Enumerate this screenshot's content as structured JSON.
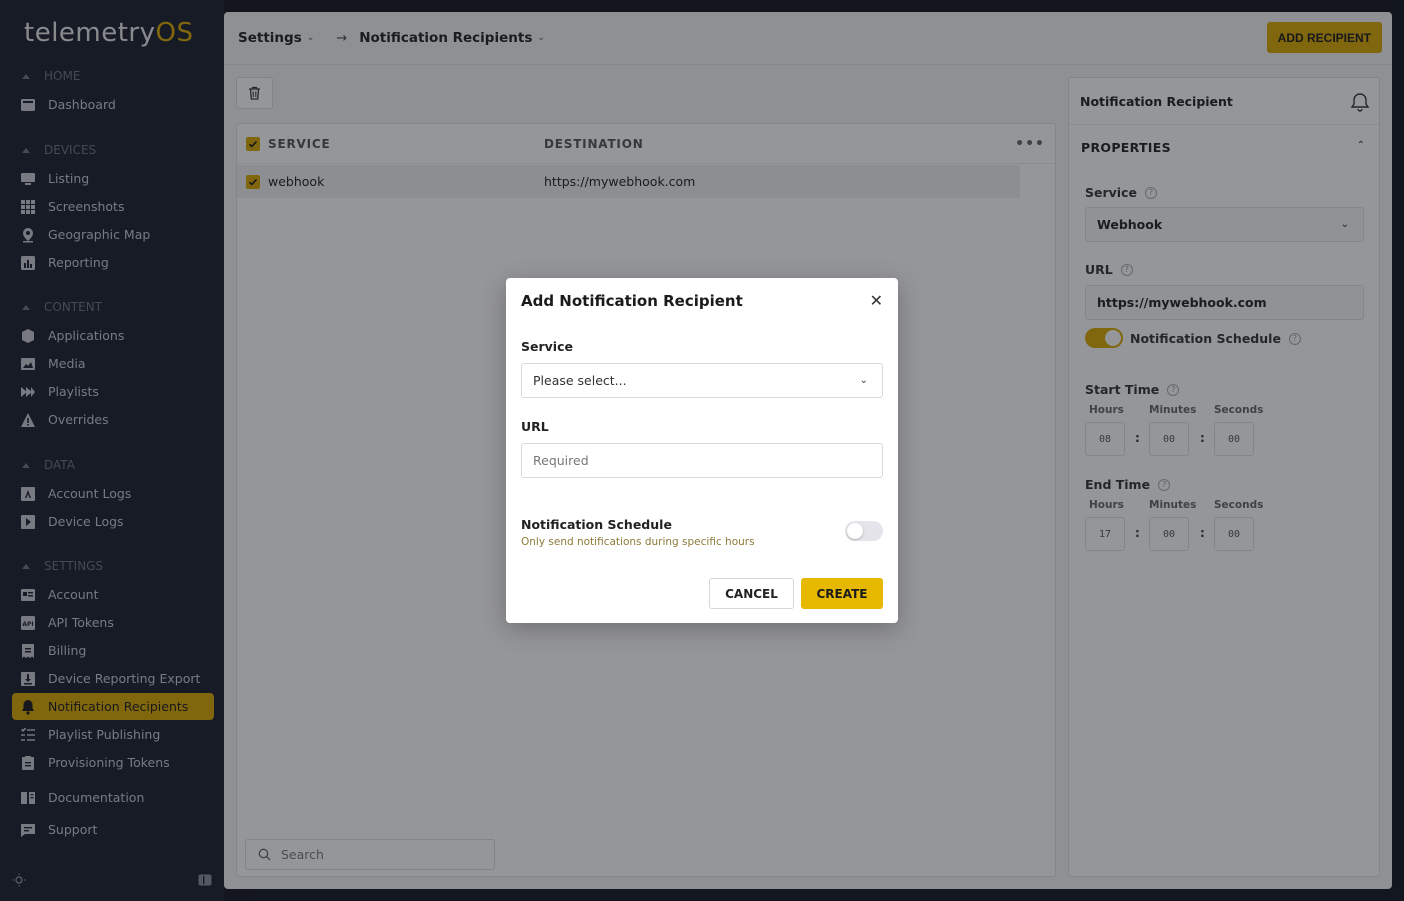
{
  "app": {
    "logo_main": "telemetry",
    "logo_accent": "OS"
  },
  "sidebar": {
    "sections": [
      {
        "label": "HOME",
        "items": [
          {
            "label": "Dashboard",
            "icon": "dashboard-icon"
          }
        ]
      },
      {
        "label": "DEVICES",
        "items": [
          {
            "label": "Listing",
            "icon": "monitor-icon"
          },
          {
            "label": "Screenshots",
            "icon": "grid-icon"
          },
          {
            "label": "Geographic Map",
            "icon": "map-pin-icon"
          },
          {
            "label": "Reporting",
            "icon": "chart-icon"
          }
        ]
      },
      {
        "label": "CONTENT",
        "items": [
          {
            "label": "Applications",
            "icon": "box-icon"
          },
          {
            "label": "Media",
            "icon": "image-icon"
          },
          {
            "label": "Playlists",
            "icon": "playlist-icon"
          },
          {
            "label": "Overrides",
            "icon": "warning-icon"
          }
        ]
      },
      {
        "label": "DATA",
        "items": [
          {
            "label": "Account Logs",
            "icon": "account-log-icon"
          },
          {
            "label": "Device Logs",
            "icon": "device-log-icon"
          }
        ]
      },
      {
        "label": "SETTINGS",
        "items": [
          {
            "label": "Account",
            "icon": "id-card-icon"
          },
          {
            "label": "API Tokens",
            "icon": "api-icon"
          },
          {
            "label": "Billing",
            "icon": "billing-icon"
          },
          {
            "label": "Device Reporting Export",
            "icon": "download-icon"
          },
          {
            "label": "Notification Recipients",
            "icon": "bell-icon",
            "active": true
          },
          {
            "label": "Playlist Publishing",
            "icon": "checklist-icon"
          },
          {
            "label": "Provisioning Tokens",
            "icon": "clipboard-icon"
          }
        ]
      }
    ],
    "extra": [
      {
        "label": "Documentation",
        "icon": "book-icon"
      },
      {
        "label": "Support",
        "icon": "chat-icon"
      }
    ]
  },
  "header": {
    "crumb_1": "Settings",
    "crumb_2": "Notification Recipients",
    "add_button": "ADD RECIPIENT"
  },
  "list": {
    "columns": [
      "SERVICE",
      "DESTINATION"
    ],
    "rows": [
      {
        "service": "webhook",
        "destination": "https://mywebhook.com"
      }
    ],
    "search_placeholder": "Search"
  },
  "properties": {
    "title": "Notification Recipient",
    "section": "PROPERTIES",
    "service_label": "Service",
    "service_value": "Webhook",
    "url_label": "URL",
    "url_value": "https://mywebhook.com",
    "schedule_label": "Notification Schedule",
    "schedule_enabled": true,
    "start_label": "Start Time",
    "end_label": "End Time",
    "hours_label": "Hours",
    "minutes_label": "Minutes",
    "seconds_label": "Seconds",
    "start": {
      "h": "08",
      "m": "00",
      "s": "00"
    },
    "end": {
      "h": "17",
      "m": "00",
      "s": "00"
    }
  },
  "modal": {
    "title": "Add Notification Recipient",
    "service_label": "Service",
    "service_placeholder": "Please select...",
    "url_label": "URL",
    "url_placeholder": "Required",
    "schedule_label": "Notification Schedule",
    "schedule_hint": "Only send notifications during specific hours",
    "schedule_enabled": false,
    "cancel": "CANCEL",
    "create": "CREATE"
  },
  "colors": {
    "accent": "#d9a900",
    "sidebar_bg": "#1a1f2e"
  }
}
